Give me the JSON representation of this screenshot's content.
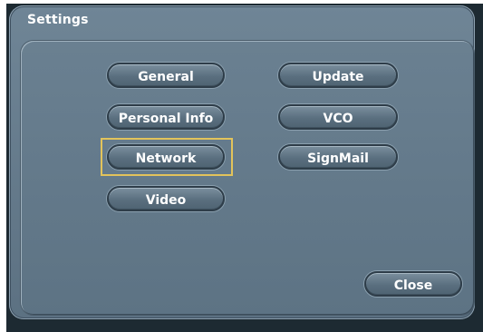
{
  "window": {
    "title": "Settings"
  },
  "buttons": {
    "general": "General",
    "personal_info": "Personal Info",
    "network": "Network",
    "video": "Video",
    "update": "Update",
    "vco": "VCO",
    "signmail": "SignMail",
    "close": "Close"
  },
  "selection": {
    "focused": "network",
    "focus_color": "#e2c35b"
  },
  "colors": {
    "panel": "#647a8b",
    "frame": "#1d2a32",
    "text": "#ffffff"
  }
}
